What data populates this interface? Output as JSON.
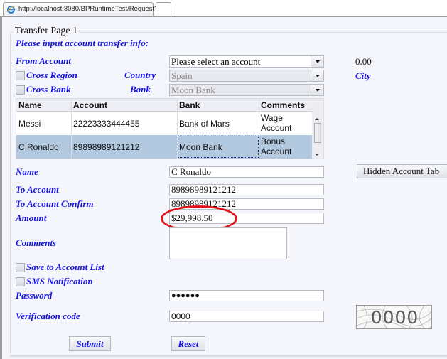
{
  "browser": {
    "tab_title": "http://localhost:8080/BPRuntimeTest/Request?ds...",
    "tab_icon": "ie-browser-icon"
  },
  "form": {
    "legend": "Transfer Page 1",
    "instruction": "Please input account transfer info:",
    "from_account": {
      "label": "From Account",
      "selected": "Please select an account",
      "balance": "0.00"
    },
    "cross_region": {
      "label": "Cross Region",
      "checked": false
    },
    "country": {
      "label": "Country",
      "selected": "Spain",
      "disabled": true
    },
    "city": {
      "label": "City"
    },
    "cross_bank": {
      "label": "Cross Bank",
      "checked": false
    },
    "bank": {
      "label": "Bank",
      "selected": "Moon Bank",
      "disabled": true
    },
    "accounts_grid": {
      "columns": [
        "Name",
        "Account",
        "Bank",
        "Comments"
      ],
      "rows": [
        {
          "name": "Messi",
          "account": "22223333444455",
          "bank": "Bank of Mars",
          "comments_line1": "Wage",
          "comments_line2": "Account",
          "selected": false
        },
        {
          "name": "C Ronaldo",
          "account": "89898989121212",
          "bank": "Moon Bank",
          "comments_line1": "Bonus",
          "comments_line2": "Account",
          "selected": true
        }
      ]
    },
    "hidden_account_table_button": "Hidden Account Tab",
    "name": {
      "label": "Name",
      "value": "C Ronaldo"
    },
    "to_account": {
      "label": "To Account",
      "value": "89898989121212"
    },
    "to_account_confirm": {
      "label": "To Account Confirm",
      "value": "89898989121212"
    },
    "amount": {
      "label": "Amount",
      "value": "$29,998.50",
      "annotation_color": "#e0141c"
    },
    "comments": {
      "label": "Comments",
      "value": ""
    },
    "save_to_account_list": {
      "label": "Save to Account List",
      "checked": false
    },
    "sms_notification": {
      "label": "SMS Notification",
      "checked": false
    },
    "password": {
      "label": "Password",
      "masked_value": "●●●●●●"
    },
    "verification_code": {
      "label": "Verification code",
      "value": "0000",
      "captcha_text": "0000"
    },
    "submit_label": "Submit",
    "reset_label": "Reset"
  },
  "colors": {
    "label_blue": "#1414e6",
    "selected_row": "#b1c8df",
    "page_bg": "#f5f6fc"
  }
}
